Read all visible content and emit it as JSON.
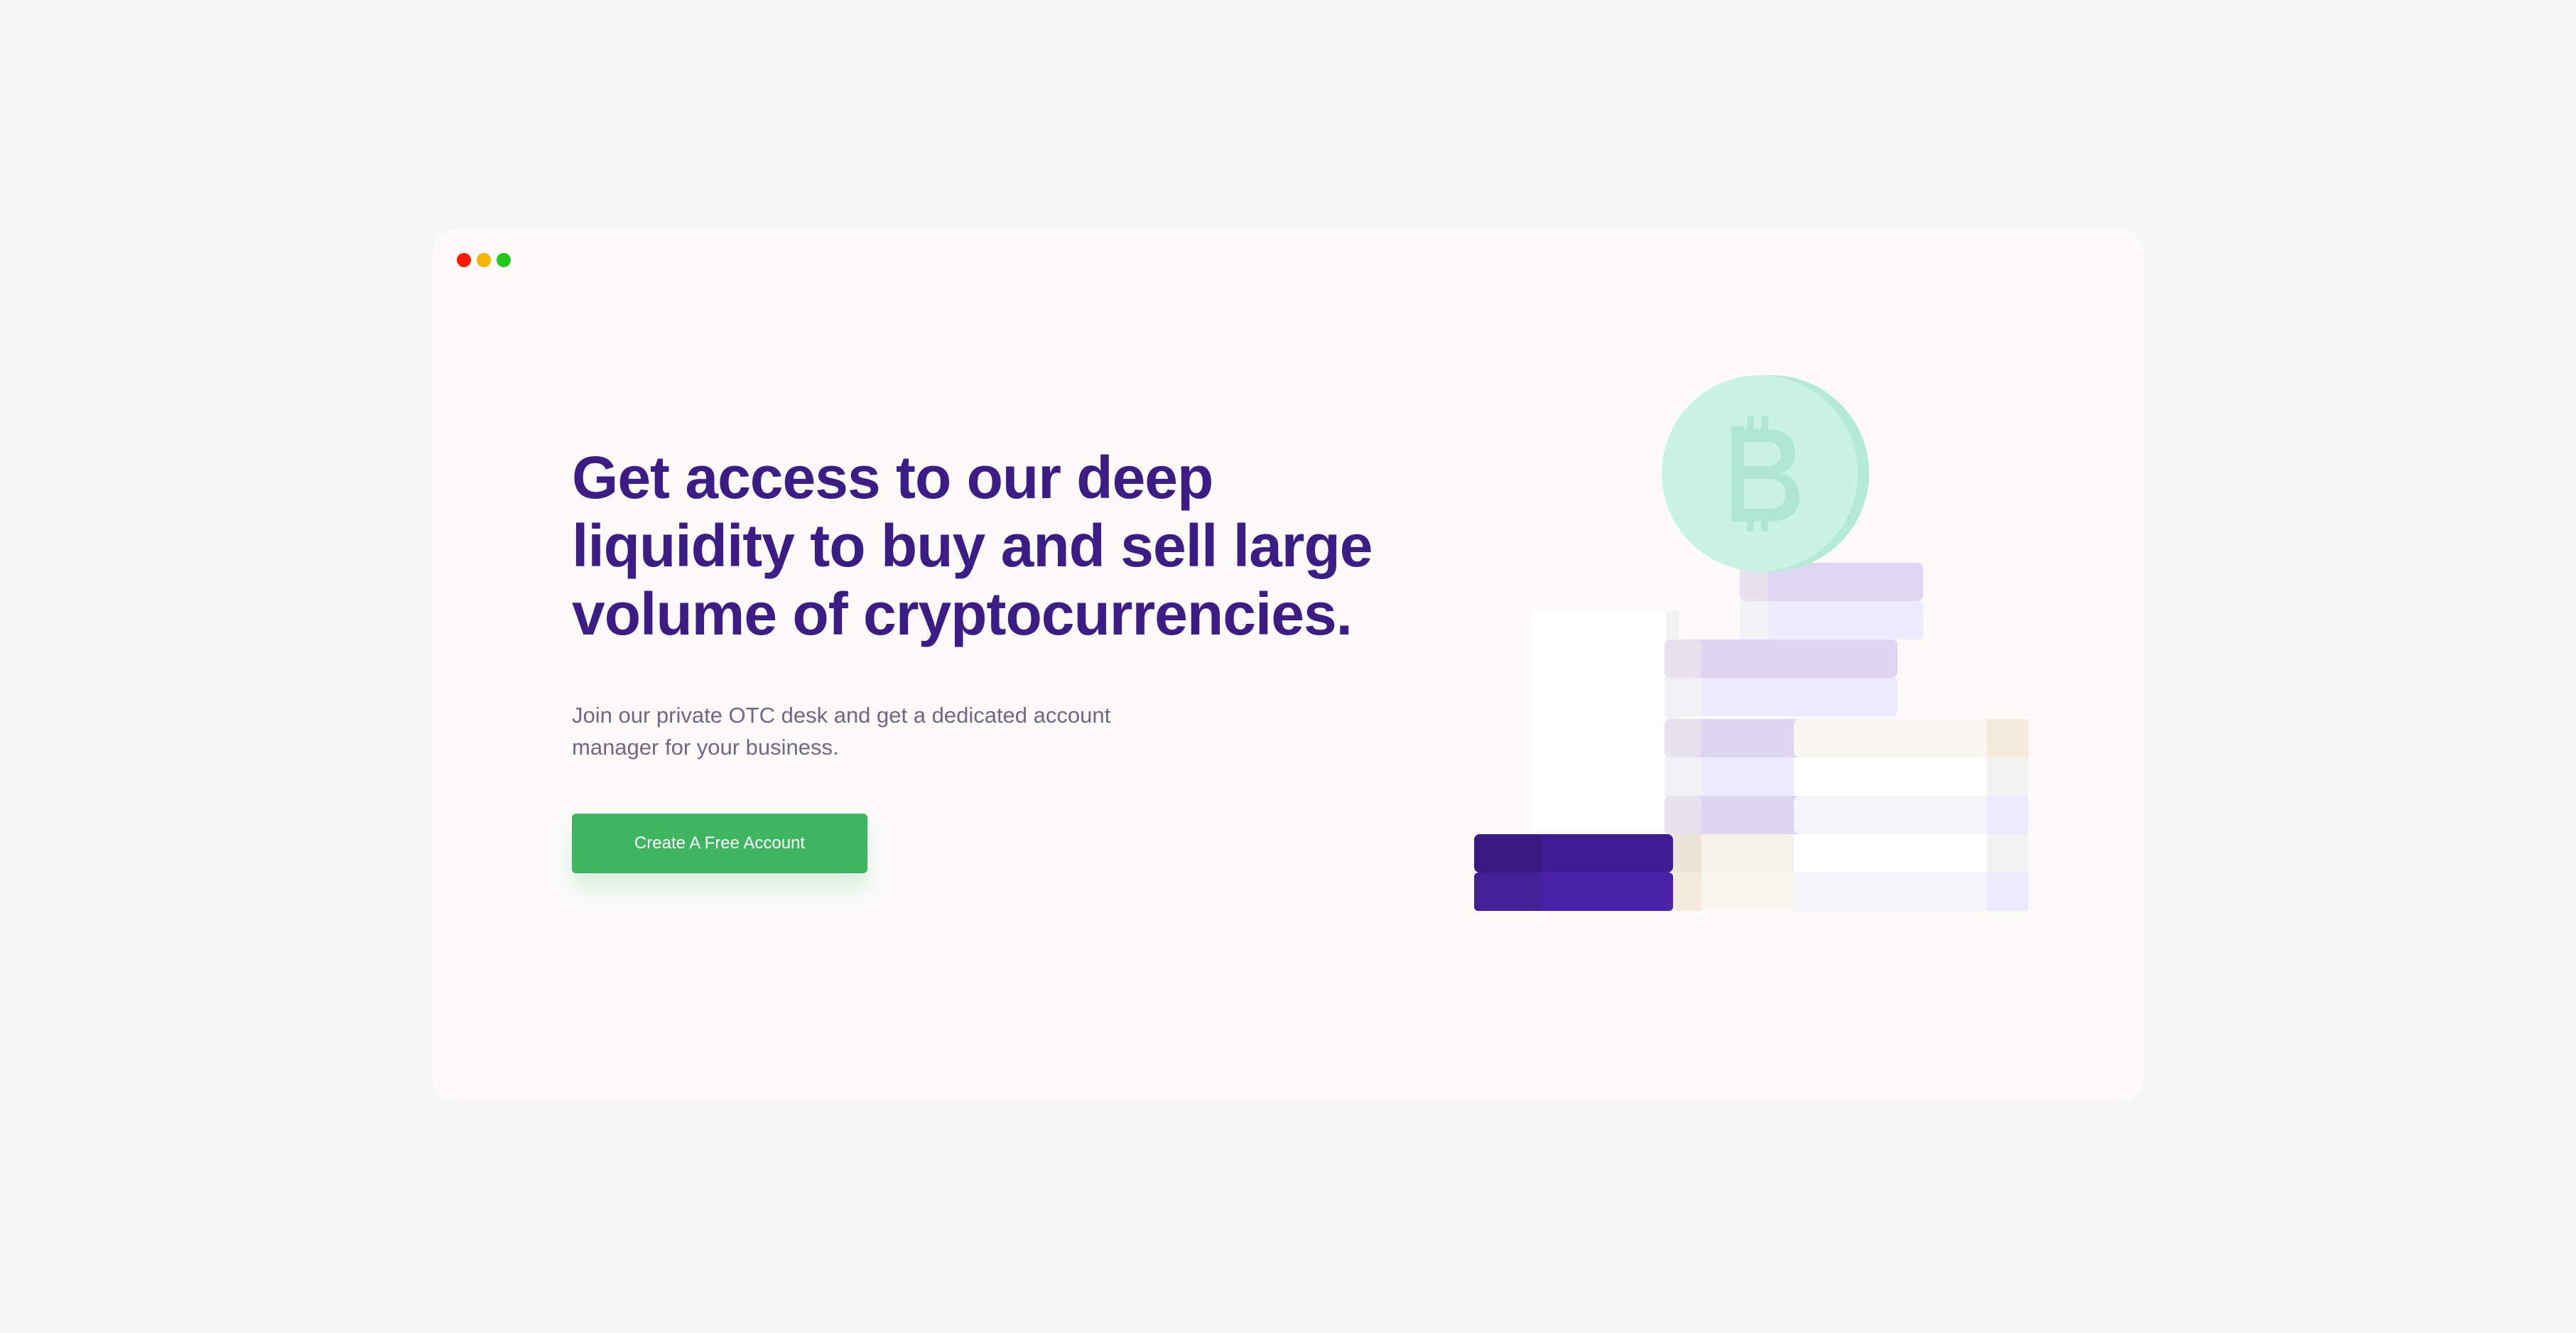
{
  "window": {
    "controls": [
      "close",
      "minimize",
      "maximize"
    ]
  },
  "hero": {
    "headline": "Get access to our deep liquidity to buy and sell large volume of cryptocurrencies.",
    "subline": "Join our private OTC desk and get a dedicated account manager for your business.",
    "cta_label": "Create A Free Account"
  },
  "illustration": {
    "coin_icon": "bitcoin-icon",
    "description_icon": "coin-stacks-illustration"
  },
  "colors": {
    "headline": "#3b1d85",
    "cta": "#3db561",
    "coin": "#c9f4e2",
    "purple_stack": "#4522a3"
  }
}
